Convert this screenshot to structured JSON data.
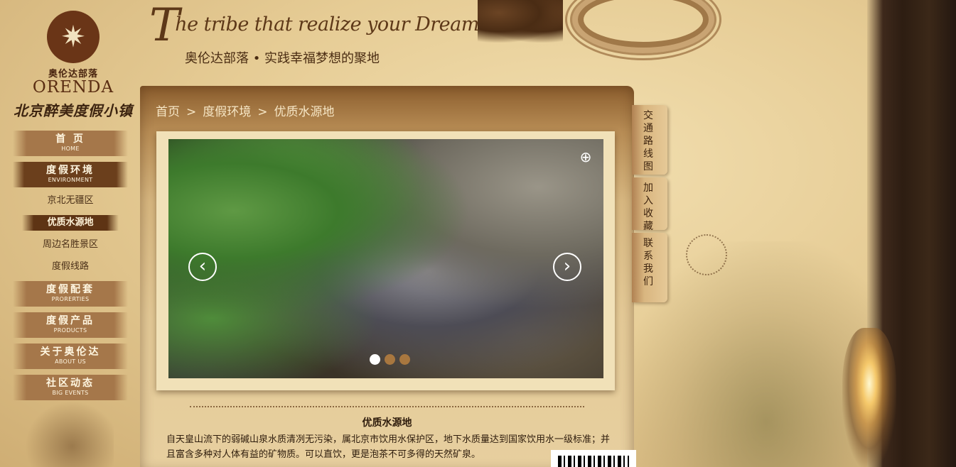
{
  "logo": {
    "emblem_icon": "sun-star-emblem-icon",
    "name_cn": "奥伦达部落",
    "name_en": "ORENDA",
    "subtitle_cn": "北京醉美度假小镇"
  },
  "slogan": {
    "initial": "T",
    "en": "he tribe that realize your Dream",
    "cn": "奥伦达部落 • 实践幸福梦想的聚地"
  },
  "nav": {
    "home": {
      "cn": "首 页",
      "en": "HOME"
    },
    "environment": {
      "cn": "度假环境",
      "en": "ENVIRONMENT"
    },
    "sub_items": [
      "京北无疆区",
      "优质水源地",
      "周边名胜景区",
      "度假线路"
    ],
    "properties": {
      "cn": "度假配套",
      "en": "PRORERTIES"
    },
    "products": {
      "cn": "度假产品",
      "en": "PRODUCTS"
    },
    "about": {
      "cn": "关于奥伦达",
      "en": "ABOUT US"
    },
    "events": {
      "cn": "社区动态",
      "en": "BIG EVENTS"
    }
  },
  "breadcrumb": {
    "items": [
      "首页",
      "度假环境",
      "优质水源地"
    ],
    "separator": ">"
  },
  "gallery": {
    "prev_icon": "chevron-left-icon",
    "next_icon": "chevron-right-icon",
    "zoom_icon": "zoom-in-icon",
    "prev_glyph": "‹",
    "next_glyph": "›",
    "zoom_glyph": "⊕",
    "slide_count": 3,
    "active_slide": 1
  },
  "content": {
    "title": "优质水源地",
    "body": "自天皇山流下的弱碱山泉水质清冽无污染，属北京市饮用水保护区，地下水质量达到国家饮用水一级标准；并且富含多种对人体有益的矿物质。可以直饮，更是泡茶不可多得的天然矿泉。"
  },
  "side_tabs": [
    "交通路线图",
    "加入收藏",
    "联系我们"
  ],
  "colors": {
    "brand_brown": "#6a3517",
    "nav_button": "#a5774a",
    "nav_active": "#6b3f1c",
    "parchment": "#e6cc95",
    "breadcrumb_text": "#f6e6c5"
  }
}
